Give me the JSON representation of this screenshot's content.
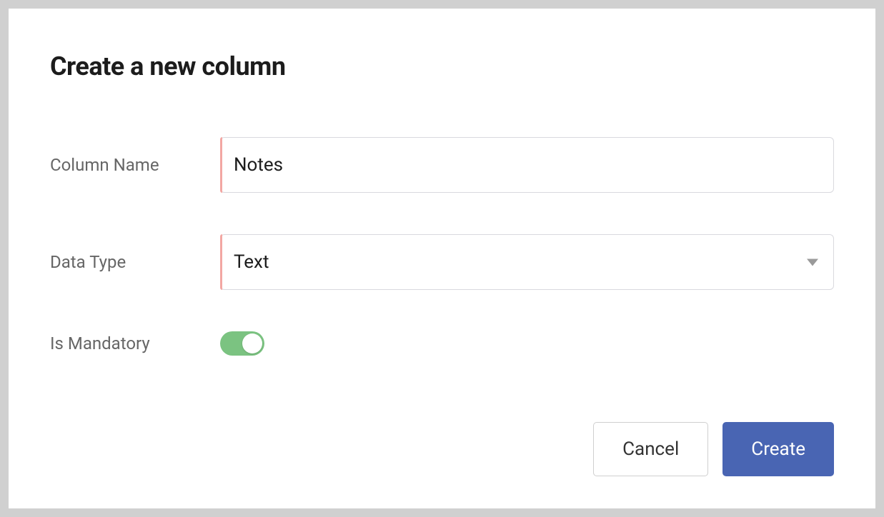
{
  "dialog": {
    "title": "Create a new column",
    "fields": {
      "column_name": {
        "label": "Column Name",
        "value": "Notes",
        "required": true
      },
      "data_type": {
        "label": "Data Type",
        "value": "Text",
        "required": true
      },
      "is_mandatory": {
        "label": "Is Mandatory",
        "value": true
      }
    },
    "actions": {
      "cancel": "Cancel",
      "create": "Create"
    }
  },
  "colors": {
    "primary": "#4965b3",
    "toggle_on": "#7bc381",
    "required_marker": "#f3a7a3",
    "text_muted": "#666666",
    "border": "#d9d9de"
  }
}
